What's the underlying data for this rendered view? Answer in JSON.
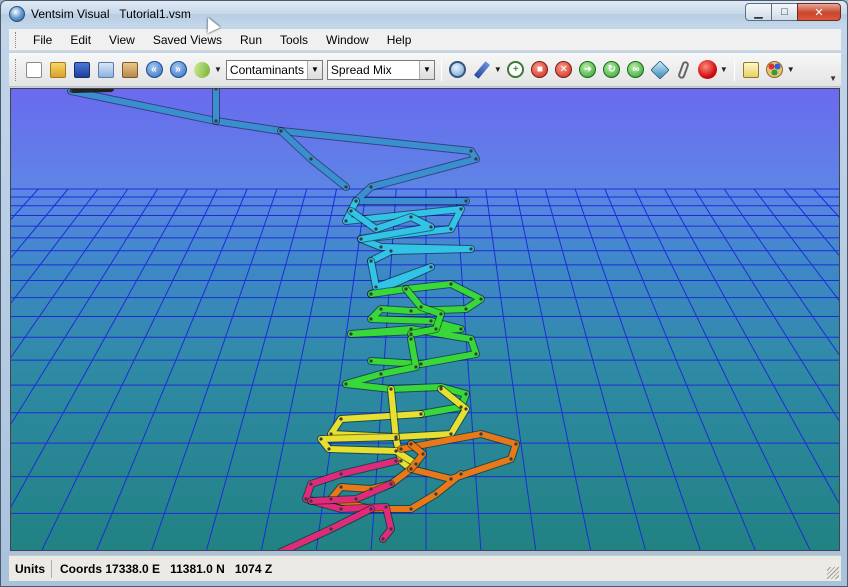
{
  "window": {
    "app_name": "Ventsim Visual",
    "file_name": "Tutorial1.vsm",
    "minimize_label": "▁",
    "maximize_label": "□",
    "close_label": "✕"
  },
  "menu": {
    "items": [
      "File",
      "Edit",
      "View",
      "Saved Views",
      "Run",
      "Tools",
      "Window",
      "Help"
    ]
  },
  "toolbar": {
    "buttons": [
      {
        "icon": "new-file-icon",
        "color": "#ffffff"
      },
      {
        "icon": "open-folder-icon",
        "color": "#e8b83a"
      },
      {
        "icon": "save-disk-icon",
        "color": "#2a57b8"
      },
      {
        "icon": "copy-icon",
        "color": "#8fb2e0"
      },
      {
        "icon": "paste-icon",
        "color": "#c79a4e"
      },
      {
        "icon": "rewind-icon",
        "color": "#3a78d0"
      },
      {
        "icon": "fast-forward-icon",
        "color": "#3a78d0"
      },
      {
        "icon": "airway-tool-icon",
        "color": "#7fbf3f"
      }
    ],
    "display_combo_value": "Contaminants",
    "mode_combo_value": "Spread Mix",
    "tools": [
      {
        "icon": "zoom-icon",
        "color": "#4a7fb8"
      },
      {
        "icon": "pen-icon",
        "color": "#3b5fb0"
      },
      {
        "icon": "add-airway-icon",
        "color": "#5fb04a"
      },
      {
        "icon": "stop-icon",
        "color": "#d93a2a"
      },
      {
        "icon": "delete-icon",
        "color": "#d93a2a"
      },
      {
        "icon": "go-forward-icon",
        "color": "#38a83a"
      },
      {
        "icon": "refresh-icon",
        "color": "#38a83a"
      },
      {
        "icon": "link-icon",
        "color": "#38a83a"
      },
      {
        "icon": "view-3d-icon",
        "color": "#4aa0c8"
      },
      {
        "icon": "attach-icon",
        "color": "#666666"
      },
      {
        "icon": "color-ball-icon",
        "color": "#e02020"
      },
      {
        "icon": "notes-icon",
        "color": "#e0c040"
      },
      {
        "icon": "palette-icon",
        "color": "#d89a3a"
      }
    ]
  },
  "status": {
    "units_label": "Units",
    "coords_label": "Coords",
    "easting": "17338.0 E",
    "northing": "11381.0 N",
    "elevation": "1074 Z"
  },
  "colors": {
    "top_airway": "#3a8fd0",
    "upper_levels": "#32c4e6",
    "mid_levels": "#38d838",
    "lower_levels": "#e8e030",
    "bottom_levels": "#e87818",
    "deepest": "#e02a7a"
  }
}
